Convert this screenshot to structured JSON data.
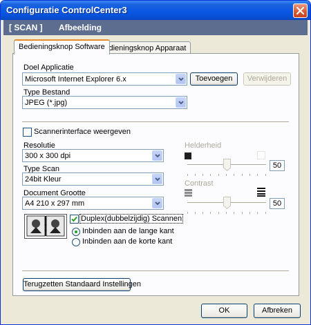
{
  "window": {
    "title": "Configuratie ControlCenter3"
  },
  "header": {
    "scan_label": "[  SCAN  ]",
    "section_label": "Afbeelding"
  },
  "tabs": [
    {
      "label": "Bedieningsknop Software",
      "active": true
    },
    {
      "label": "Bedieningsknop Apparaat",
      "active": false
    }
  ],
  "doel_applicatie": {
    "label": "Doel Applicatie",
    "value": "Microsoft Internet Explorer 6.x",
    "add_button": "Toevoegen",
    "remove_button": "Verwijderen"
  },
  "type_bestand": {
    "label": "Type Bestand",
    "value": "JPEG (*.jpg)"
  },
  "scanner_interface": {
    "label": "Scannerinterface weergeven",
    "checked": false
  },
  "resolutie": {
    "label": "Resolutie",
    "value": "300 x 300 dpi"
  },
  "type_scan": {
    "label": "Type Scan",
    "value": "24bit Kleur"
  },
  "document_grootte": {
    "label": "Document Grootte",
    "value": "A4 210 x 297 mm"
  },
  "helderheid": {
    "label": "Helderheid",
    "value": "50",
    "level": 0.5
  },
  "contrast": {
    "label": "Contrast",
    "value": "50",
    "level": 0.5
  },
  "duplex": {
    "label": "Duplex(dubbelzijdig) Scannen",
    "checked": true,
    "options": [
      "Inbinden aan de lange kant",
      "Inbinden aan de korte kant"
    ],
    "selected_index": 0
  },
  "reset_button": "Terugzetten Standaard Instellingen",
  "footer": {
    "ok": "OK",
    "cancel": "Afbreken"
  }
}
